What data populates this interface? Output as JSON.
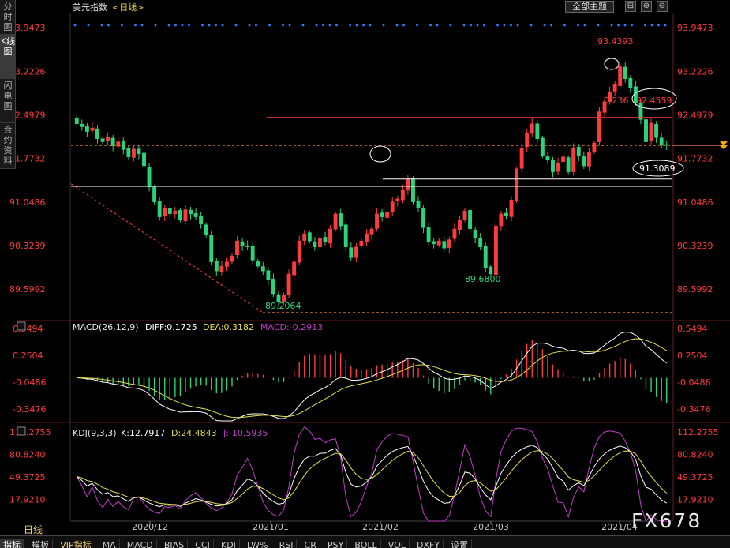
{
  "left_tabs": [
    "分时图",
    "K线图",
    "闪电图",
    "合约资料"
  ],
  "top_button": "全部主题",
  "period_label": "日线",
  "logo": "FX678",
  "colors": {
    "up": "#ff3b3b",
    "down": "#2bd37a",
    "level": "#ff3b3b",
    "dif": "#ffffff",
    "dea": "#e6e04a",
    "macd": "#c23cc8",
    "j": "#c23cc8",
    "dots": "#2e7fff"
  },
  "bottom_tabs": [
    "指标",
    "模板",
    "VIP指标",
    "MA",
    "MACD",
    "BIAS",
    "CCI",
    "KDJ",
    "LW%",
    "RSI",
    "CR",
    "PSY",
    "BOLL",
    "VOL",
    "DXFY",
    "设置"
  ],
  "chart_data": [
    {
      "type": "candlestick",
      "title": "美元指数",
      "period": "<日线>",
      "y_ticks": [
        "93.9473",
        "93.2226",
        "92.4979",
        "91.7732",
        "91.0486",
        "90.3239",
        "89.5992"
      ],
      "ylim": [
        89.1,
        94.2
      ],
      "x_ticks": [
        "2020/12",
        "2021/01",
        "2021/02",
        "2021/03",
        "2021/04"
      ],
      "annotations": {
        "high": "93.4393",
        "low_jan": "89.2064",
        "low_feb": "89.6800",
        "level_upper": "92.4559",
        "fib": "0.236",
        "level_lower": "91.3089"
      },
      "levels": [
        92.4559,
        91.3089,
        91.43,
        89.2064,
        91.99
      ],
      "closes": [
        92.35,
        92.3,
        92.22,
        92.28,
        92.1,
        92.05,
        92.13,
        91.98,
        92.05,
        91.92,
        91.8,
        91.93,
        91.85,
        91.65,
        91.3,
        91.05,
        90.8,
        90.95,
        90.85,
        90.9,
        90.75,
        90.92,
        90.85,
        90.8,
        90.68,
        90.5,
        90.05,
        89.9,
        89.98,
        90.05,
        90.15,
        90.4,
        90.32,
        90.3,
        90.08,
        89.98,
        89.9,
        89.75,
        89.52,
        89.38,
        89.5,
        89.85,
        90.05,
        90.4,
        90.52,
        90.4,
        90.3,
        90.45,
        90.38,
        90.6,
        90.85,
        90.65,
        90.3,
        90.12,
        90.3,
        90.4,
        90.52,
        90.6,
        90.85,
        90.8,
        90.88,
        91.05,
        91.1,
        91.25,
        91.43,
        91.05,
        90.95,
        90.62,
        90.38,
        90.35,
        90.4,
        90.28,
        90.42,
        90.6,
        90.75,
        90.9,
        90.6,
        90.45,
        90.3,
        89.95,
        89.85,
        90.65,
        90.85,
        90.82,
        91.08,
        91.6,
        91.95,
        92.2,
        92.35,
        92.1,
        91.82,
        91.75,
        91.55,
        91.7,
        91.8,
        91.55,
        91.95,
        91.82,
        91.65,
        91.88,
        92.03,
        92.55,
        92.72,
        92.88,
        93.0,
        93.3,
        93.1,
        92.95,
        92.7,
        92.42,
        92.05,
        92.36,
        92.12,
        92.0,
        91.99
      ],
      "macd": {
        "diff": 0.1725,
        "dea": 0.3182,
        "macd": -0.2913,
        "y_ticks": [
          "0.5494",
          "0.2504",
          "-0.0486",
          "-0.3476"
        ],
        "ylim": [
          -0.48,
          0.62
        ]
      },
      "kdj": {
        "k": 12.7917,
        "d": 24.4843,
        "j": -10.5935,
        "y_ticks": [
          "112.2755",
          "80.8240",
          "49.3725",
          "17.9210"
        ],
        "ylim": [
          -12,
          123
        ]
      },
      "macd_label": "MACD(26,12,9)",
      "macd_diff_label": "DIFF:0.1725",
      "macd_dea_label": "DEA:0.3182",
      "macd_macd_label": "MACD:-0.2913",
      "kdj_label": "KDJ(9,3,3)",
      "kdj_k_label": "K:12.7917",
      "kdj_d_label": "D:24.4843",
      "kdj_j_label": "J:-10.5935"
    }
  ]
}
